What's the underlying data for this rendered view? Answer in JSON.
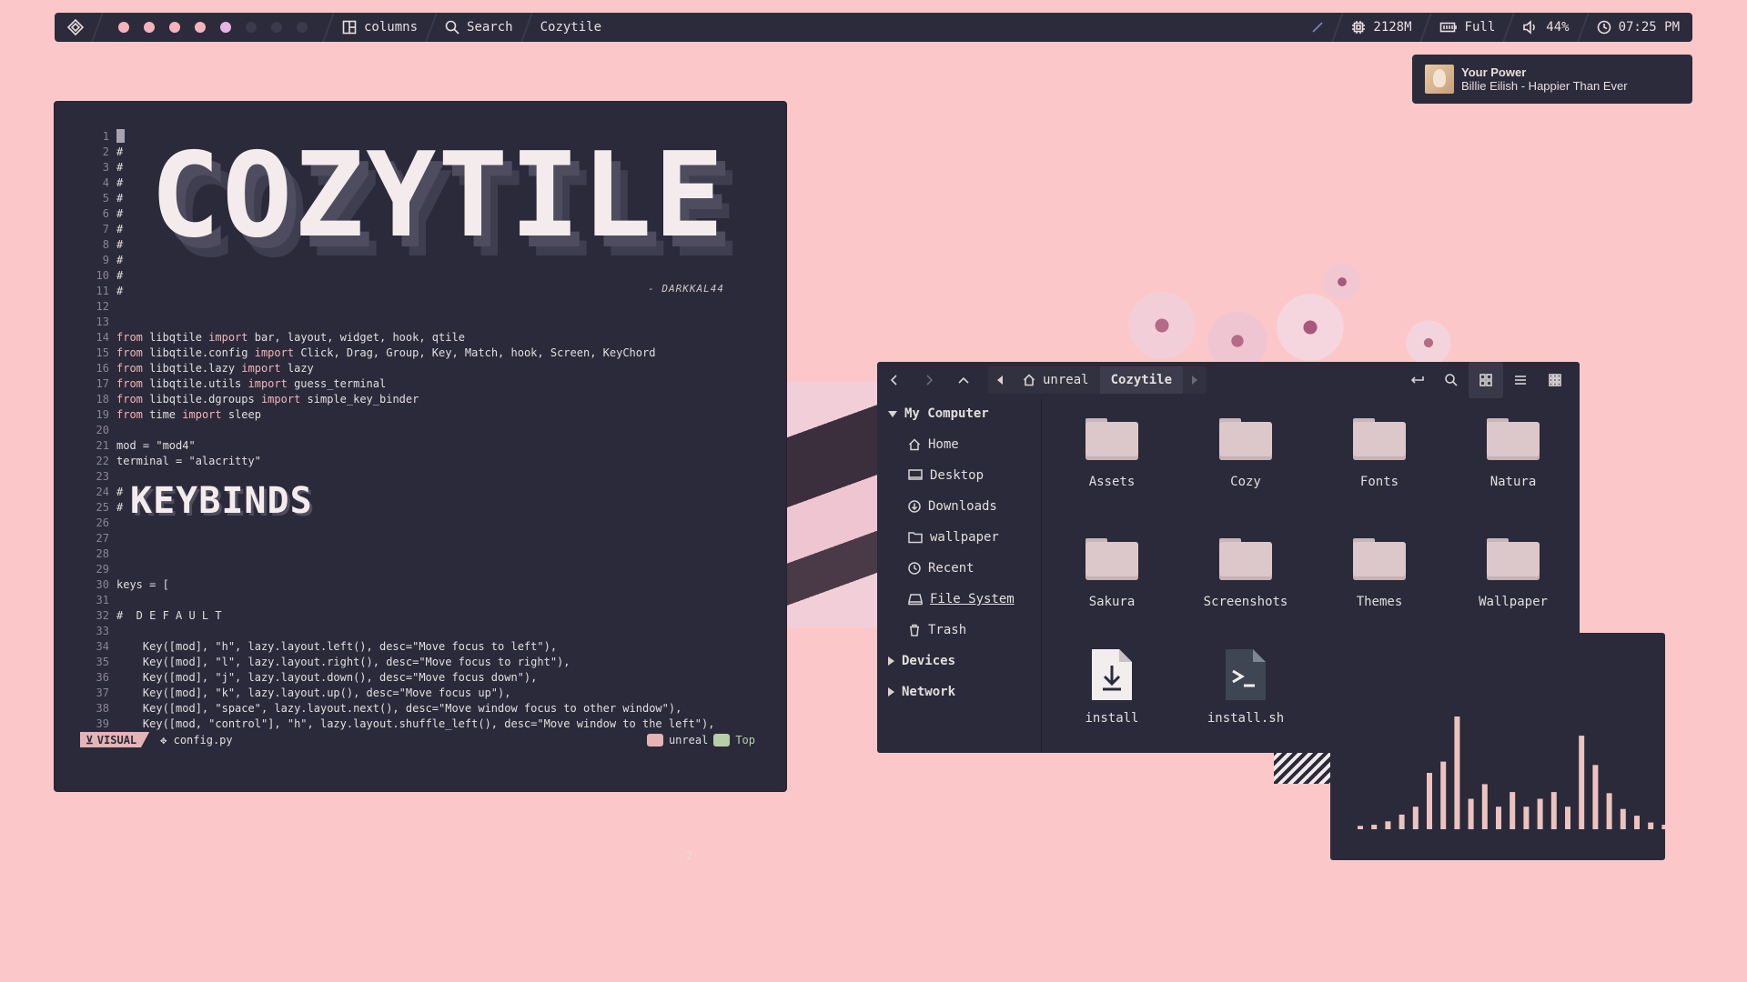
{
  "topbar": {
    "layout_label": "columns",
    "search_label": "Search",
    "window_title": "Cozytile",
    "memory": "2128M",
    "battery": "Full",
    "volume": "44%",
    "clock": "07:25 PM",
    "workspace_colors": [
      "#f6b3bb",
      "#f6b3bb",
      "#f6b3bb",
      "#f6b3bb",
      "#e7b5e1",
      "#3b3a4c",
      "#3b3a4c",
      "#3b3a4c"
    ]
  },
  "notification": {
    "title": "Your Power",
    "body": "Billie Eilish - Happier Than Ever"
  },
  "editor": {
    "ascii_title": "COZYTILE",
    "credit": "- DARKKAL44",
    "ascii_keybinds": "KEYBINDS",
    "lines": [
      {
        "n": "1",
        "t": ""
      },
      {
        "n": "2",
        "t": "#"
      },
      {
        "n": "3",
        "t": "#"
      },
      {
        "n": "4",
        "t": "#"
      },
      {
        "n": "5",
        "t": "#"
      },
      {
        "n": "6",
        "t": "#"
      },
      {
        "n": "7",
        "t": "#"
      },
      {
        "n": "8",
        "t": "#"
      },
      {
        "n": "9",
        "t": "#"
      },
      {
        "n": "10",
        "t": "#"
      },
      {
        "n": "11",
        "t": "#"
      },
      {
        "n": "12",
        "t": ""
      },
      {
        "n": "13",
        "t": ""
      },
      {
        "n": "14",
        "t": "from libqtile import bar, layout, widget, hook, qtile"
      },
      {
        "n": "15",
        "t": "from libqtile.config import Click, Drag, Group, Key, Match, hook, Screen, KeyChord"
      },
      {
        "n": "16",
        "t": "from libqtile.lazy import lazy"
      },
      {
        "n": "17",
        "t": "from libqtile.utils import guess_terminal"
      },
      {
        "n": "18",
        "t": "from libqtile.dgroups import simple_key_binder"
      },
      {
        "n": "19",
        "t": "from time import sleep"
      },
      {
        "n": "20",
        "t": ""
      },
      {
        "n": "21",
        "t": "mod = \"mod4\""
      },
      {
        "n": "22",
        "t": "terminal = \"alacritty\""
      },
      {
        "n": "23",
        "t": ""
      },
      {
        "n": "24",
        "t": "#"
      },
      {
        "n": "25",
        "t": "#"
      },
      {
        "n": "26",
        "t": ""
      },
      {
        "n": "27",
        "t": ""
      },
      {
        "n": "28",
        "t": ""
      },
      {
        "n": "29",
        "t": ""
      },
      {
        "n": "30",
        "t": "keys = ["
      },
      {
        "n": "31",
        "t": ""
      },
      {
        "n": "32",
        "t": "#  D E F A U L T"
      },
      {
        "n": "33",
        "t": ""
      },
      {
        "n": "34",
        "t": "    Key([mod], \"h\", lazy.layout.left(), desc=\"Move focus to left\"),"
      },
      {
        "n": "35",
        "t": "    Key([mod], \"l\", lazy.layout.right(), desc=\"Move focus to right\"),"
      },
      {
        "n": "36",
        "t": "    Key([mod], \"j\", lazy.layout.down(), desc=\"Move focus down\"),"
      },
      {
        "n": "37",
        "t": "    Key([mod], \"k\", lazy.layout.up(), desc=\"Move focus up\"),"
      },
      {
        "n": "38",
        "t": "    Key([mod], \"space\", lazy.layout.next(), desc=\"Move window focus to other window\"),"
      },
      {
        "n": "39",
        "t": "    Key([mod, \"control\"], \"h\", lazy.layout.shuffle_left(), desc=\"Move window to the left\"),"
      }
    ],
    "status": {
      "mode": "VISUAL",
      "file": "config.py",
      "branch": "unreal",
      "position": "Top",
      "cmd": "2"
    }
  },
  "file_manager": {
    "crumbs": [
      "unreal",
      "Cozytile"
    ],
    "sidebar": {
      "section": "My Computer",
      "items": [
        "Home",
        "Desktop",
        "Downloads",
        "wallpaper",
        "Recent",
        "File System",
        "Trash"
      ],
      "collapsed": [
        "Devices",
        "Network"
      ]
    },
    "folders": [
      "Assets",
      "Cozy",
      "Fonts",
      "Natura",
      "Sakura",
      "Screenshots",
      "Themes",
      "Wallpaper"
    ],
    "files": [
      {
        "name": "install",
        "icon": "download-file-icon"
      },
      {
        "name": "install.sh",
        "icon": "terminal-file-icon"
      }
    ]
  },
  "visualizer": {
    "bar_levels": [
      0.03,
      0.04,
      0.07,
      0.13,
      0.2,
      0.5,
      0.6,
      1.0,
      0.27,
      0.4,
      0.2,
      0.33,
      0.2,
      0.27,
      0.33,
      0.2,
      0.83,
      0.57,
      0.32,
      0.18,
      0.12,
      0.06,
      0.04,
      0.04
    ],
    "bar_color": "#ecc3bf"
  }
}
